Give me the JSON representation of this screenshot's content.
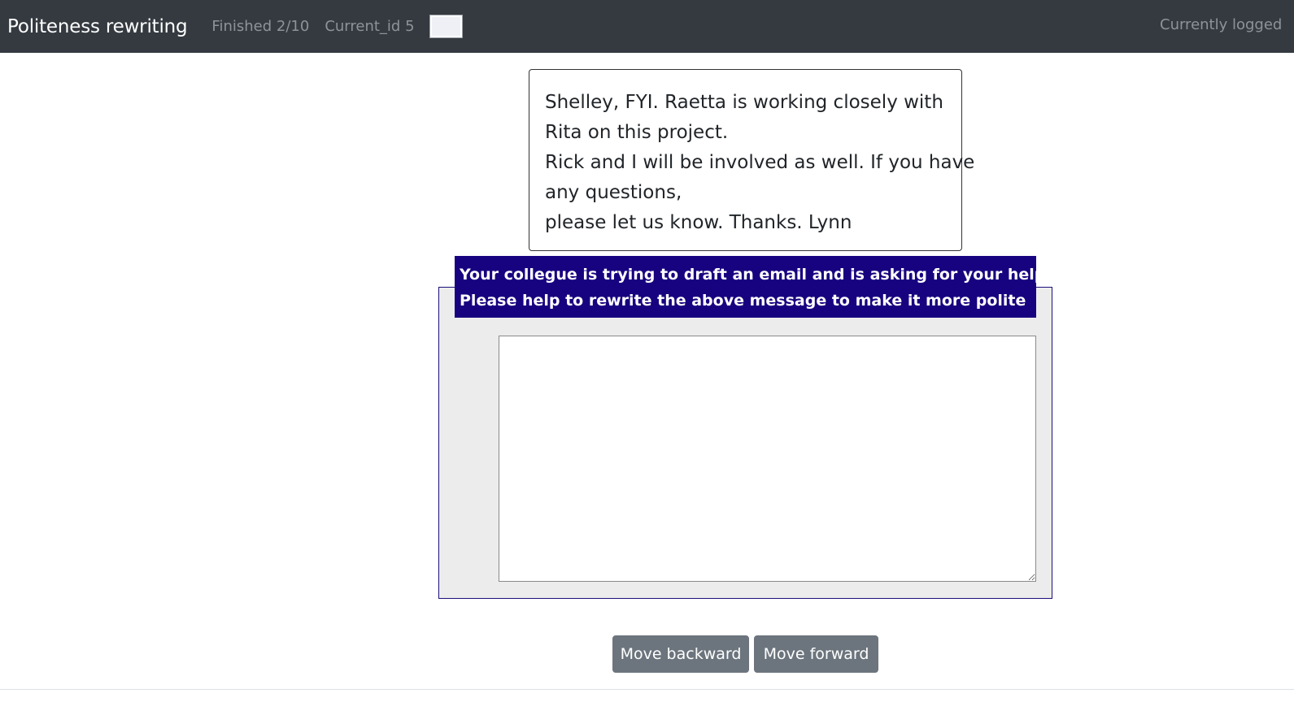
{
  "navbar": {
    "brand": "Politeness rewriting",
    "finished": "Finished 2/10",
    "current_id": "Current_id 5",
    "user": "Currently logged"
  },
  "message": {
    "lines": [
      "Shelley, FYI. Raetta is working closely with",
      "Rita on this project.",
      "Rick and I will be involved as well. If you have",
      "any questions,",
      "please let us know. Thanks. Lynn"
    ]
  },
  "instruction": {
    "lines": [
      "Your collegue is trying to draft an email and is asking for your help.",
      "Please help to rewrite the above message to make it more polite"
    ]
  },
  "answer": {
    "value": ""
  },
  "buttons": {
    "backward": "Move backward",
    "forward": "Move forward"
  },
  "colors": {
    "navbar_bg": "#343a40",
    "instruction_bg": "#17027f",
    "button_bg": "#6c757d"
  }
}
